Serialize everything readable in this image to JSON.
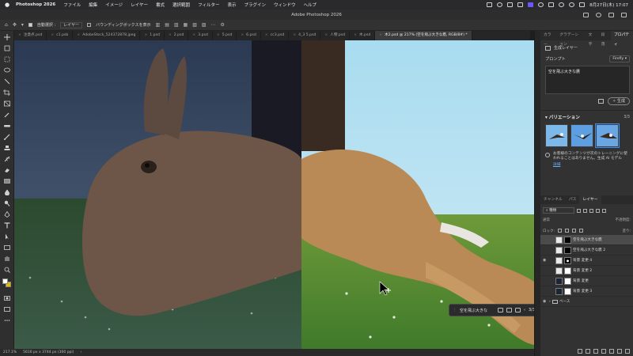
{
  "menubar": {
    "app_name": "Photoshop 2026",
    "items": [
      "ファイル",
      "編集",
      "イメージ",
      "レイヤー",
      "書式",
      "選択範囲",
      "フィルター",
      "表示",
      "プラグイン",
      "ウィンドウ",
      "ヘルプ"
    ],
    "clock": "8月27日(木) 17:07"
  },
  "window": {
    "title": "Adobe Photoshop 2026"
  },
  "options": {
    "auto_select_label": "自動選択 :",
    "auto_select_target": "レイヤー",
    "bounding_box_label": "バウンディングボックスを表示"
  },
  "tabs": [
    {
      "label": "注意点.psd"
    },
    {
      "label": "c1.psb"
    },
    {
      "label": "AdobeStock_524372878.jpeg"
    },
    {
      "label": "1.psd"
    },
    {
      "label": "2.psd"
    },
    {
      "label": "3.psd"
    },
    {
      "label": "5.psd"
    },
    {
      "label": "6.psd"
    },
    {
      "label": "cc3.psd"
    },
    {
      "label": "4_3 5.psd"
    },
    {
      "label": "人物.psd"
    },
    {
      "label": "木.psd"
    },
    {
      "label": "木2.psd @ 217% (空を飛ぶ大きな鷹, RGB/8#) *",
      "active": true
    }
  ],
  "statusbar": {
    "zoom": "217.1%",
    "doc_size": "5616 px x 3744 px (300 ppi)"
  },
  "right_tabs": {
    "items": [
      "カラー",
      "グラデーション",
      "文字",
      "段落",
      "プロパティ"
    ],
    "active": "プロパティ"
  },
  "generative": {
    "header": "生成レイヤー",
    "prompt_label": "プロンプト",
    "model": "Firefly",
    "prompt_text": "空を飛ぶ大きな鷹",
    "generate_label": "生成",
    "variations_label": "バリエーション",
    "variations_count": "3/3",
    "notice": "お客様のコンテンツが次のトレーニングに使われることはありません。生成 AI モデル",
    "notice_link": "詳細"
  },
  "layers_panel": {
    "tabs": [
      "チャンネル",
      "パス",
      "レイヤー"
    ],
    "active_tab": "レイヤー",
    "filter_kind": "種類",
    "blend_mode": "通常",
    "opacity_label": "不透明度:",
    "fill_label": "塗り:",
    "lock_label": "ロック:",
    "layers": [
      {
        "name": "空を飛ぶ大きな鷹",
        "selected": true,
        "visible": false,
        "thumb": "light",
        "mask": "black"
      },
      {
        "name": "空を飛ぶ大きな鷹 2",
        "selected": false,
        "visible": false,
        "thumb": "light",
        "mask": "black"
      },
      {
        "name": "背景 変更 4",
        "selected": false,
        "visible": true,
        "thumb": "light",
        "mask": "bird"
      },
      {
        "name": "背景 変更 2",
        "selected": false,
        "visible": false,
        "thumb": "light",
        "mask": "white"
      },
      {
        "name": "背景 変更",
        "selected": false,
        "visible": false,
        "thumb": "dark",
        "mask": "white"
      },
      {
        "name": "背景 変更 3",
        "selected": false,
        "visible": false,
        "thumb": "dark",
        "mask": "white"
      },
      {
        "name": "ベース",
        "selected": false,
        "visible": true,
        "folder": true
      }
    ]
  },
  "context_bar": {
    "prompt": "空を飛ぶ大きな",
    "count": "3/3",
    "generate_label": "生成"
  },
  "colors": {
    "accent": "#3b8ef0",
    "foreground": "#ffffff",
    "background": "#e3b800"
  }
}
